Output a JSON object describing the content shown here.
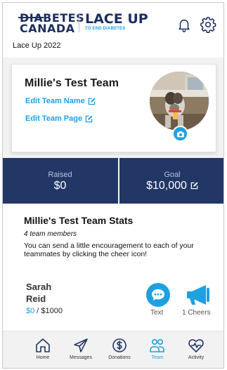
{
  "header": {
    "logo_primary_line1": "DIABETES",
    "logo_primary_line2": "CANADA",
    "logo_secondary_line1": "LACE UP",
    "logo_secondary_line2": "TO END DIABETES",
    "event_name": "Lace Up 2022",
    "icons": [
      "bell-icon",
      "gear-icon"
    ]
  },
  "team_card": {
    "team_name": "Millie's Test Team",
    "edit_name_label": "Edit Team Name",
    "edit_page_label": "Edit Team Page",
    "icons": [
      "edit-icon",
      "camera-icon"
    ]
  },
  "fundraising": {
    "raised_label": "Raised",
    "raised_value": "$0",
    "goal_label": "Goal",
    "goal_value": "$10,000"
  },
  "team_stats": {
    "title": "Millie's Test Team Stats",
    "member_count": "4 team members",
    "note": "You can send a little encouragement to each of your teammates by clicking the cheer icon!",
    "members": [
      {
        "first_name": "Sarah",
        "last_name": "Reid",
        "raised": "$0",
        "separator": " / ",
        "goal": "$1000",
        "text_label": "Text",
        "cheers_label": "1 Cheers"
      }
    ]
  },
  "nav": {
    "items": [
      {
        "label": "Home",
        "icon": "home-icon"
      },
      {
        "label": "Messages",
        "icon": "send-icon"
      },
      {
        "label": "Donations",
        "icon": "dollar-icon"
      },
      {
        "label": "Team",
        "icon": "team-icon",
        "active": true
      },
      {
        "label": "Activity",
        "icon": "heartbeat-icon"
      }
    ]
  },
  "colors": {
    "navy": "#233766",
    "accent": "#1fa0e0",
    "logo": "#1c2d5f"
  }
}
